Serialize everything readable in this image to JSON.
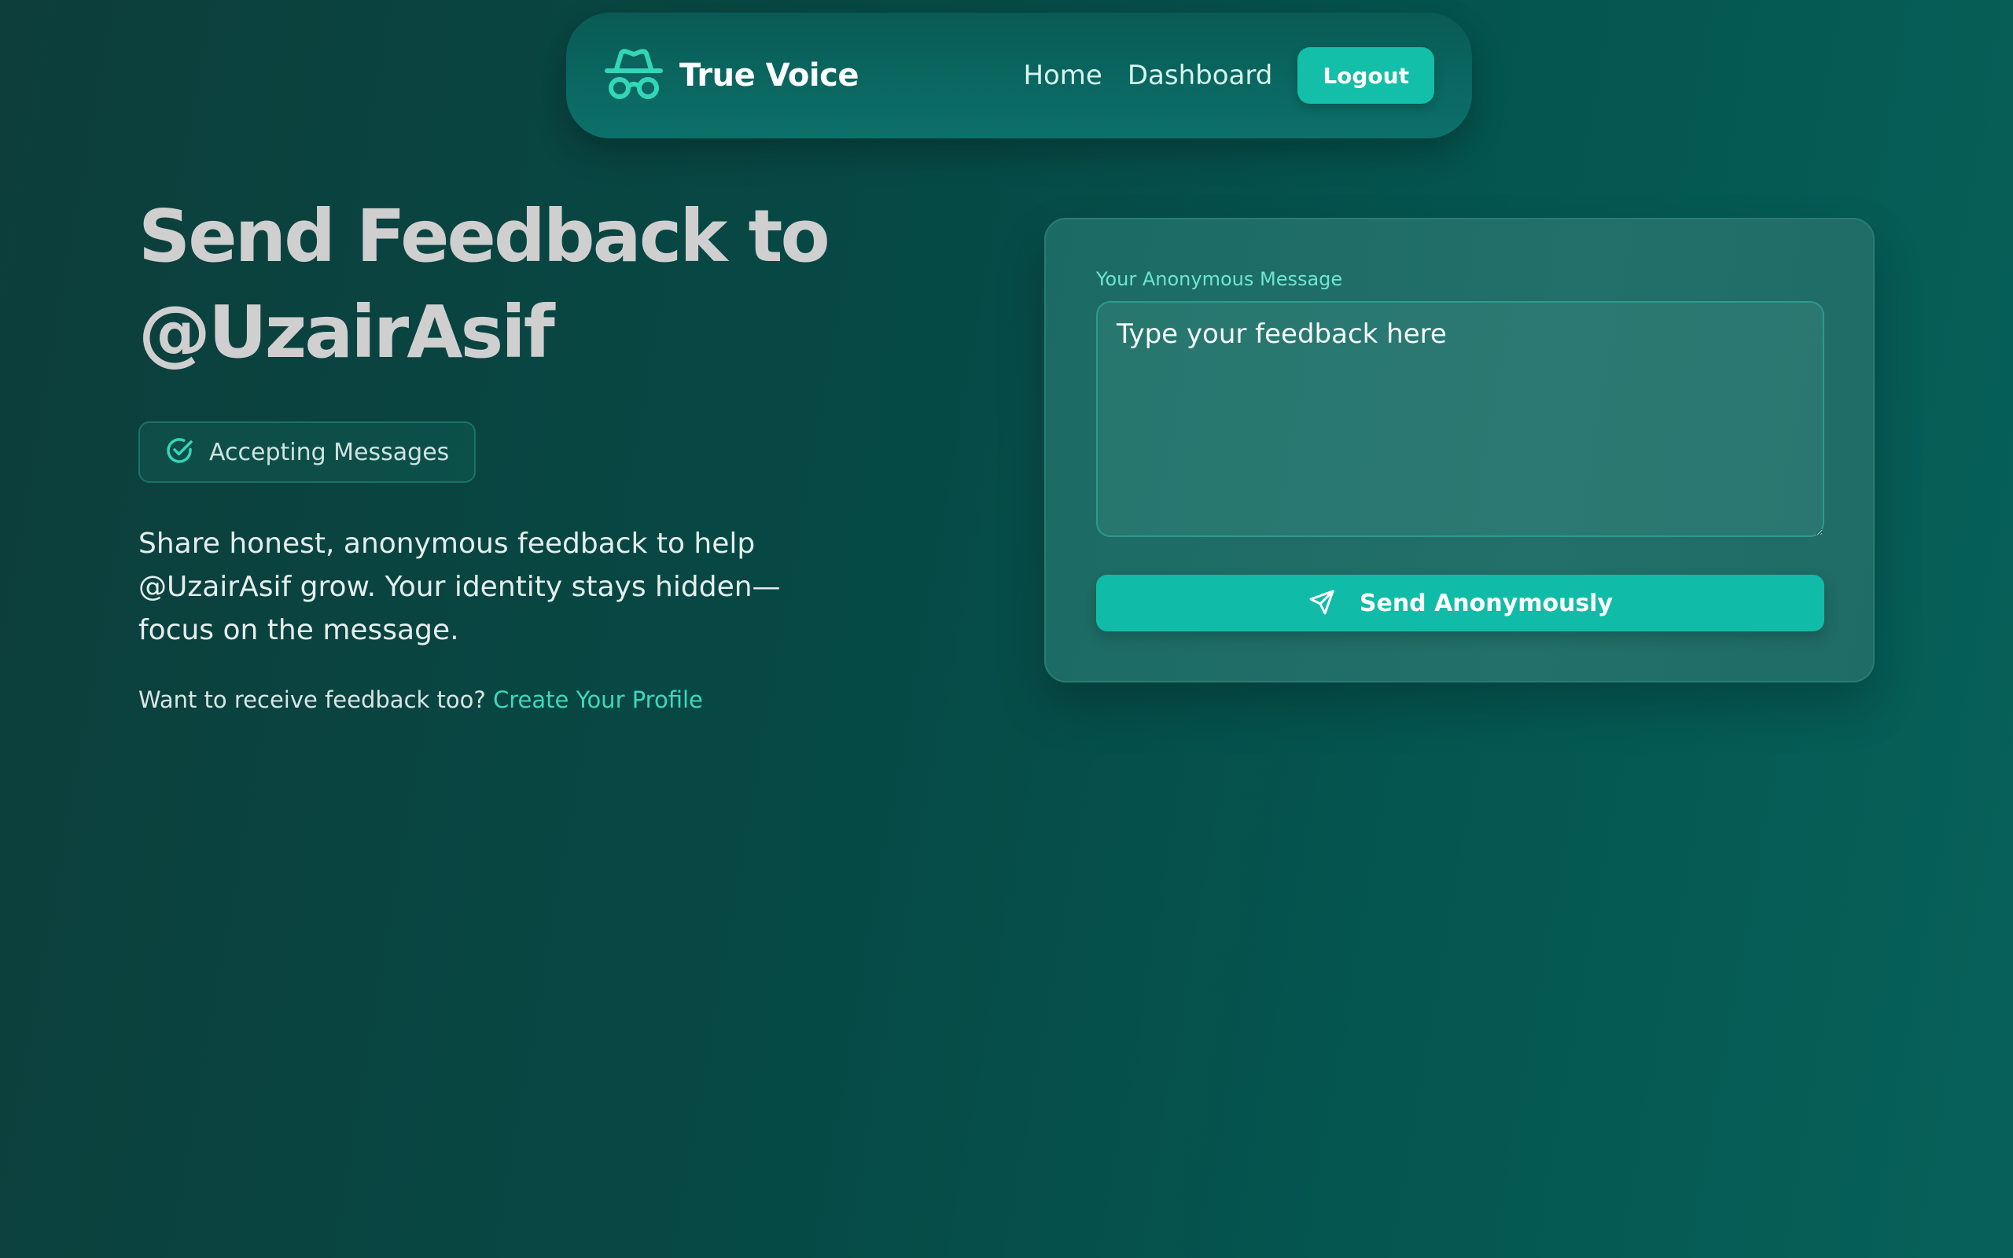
{
  "navbar": {
    "brand_name": "True Voice",
    "brand_icon": "incognito-icon",
    "links": {
      "home": "Home",
      "dashboard": "Dashboard"
    },
    "logout_label": "Logout"
  },
  "hero": {
    "title_line1": "Send Feedback to",
    "title_line2": "@UzairAsif",
    "status": {
      "icon": "check-circle-icon",
      "label": "Accepting Messages"
    },
    "description": "Share honest, anonymous feedback to help @UzairAsif grow. Your identity stays hidden—focus on the message.",
    "cta_text": "Want to receive feedback too?",
    "cta_link": "Create Your Profile"
  },
  "form": {
    "label": "Your Anonymous Message",
    "placeholder": "Type your feedback here",
    "value": "",
    "submit_icon": "send-icon",
    "submit_label": "Send Anonymously"
  },
  "colors": {
    "accent": "#13bfa8",
    "link": "#3dd9bd",
    "background": "#064a46"
  }
}
